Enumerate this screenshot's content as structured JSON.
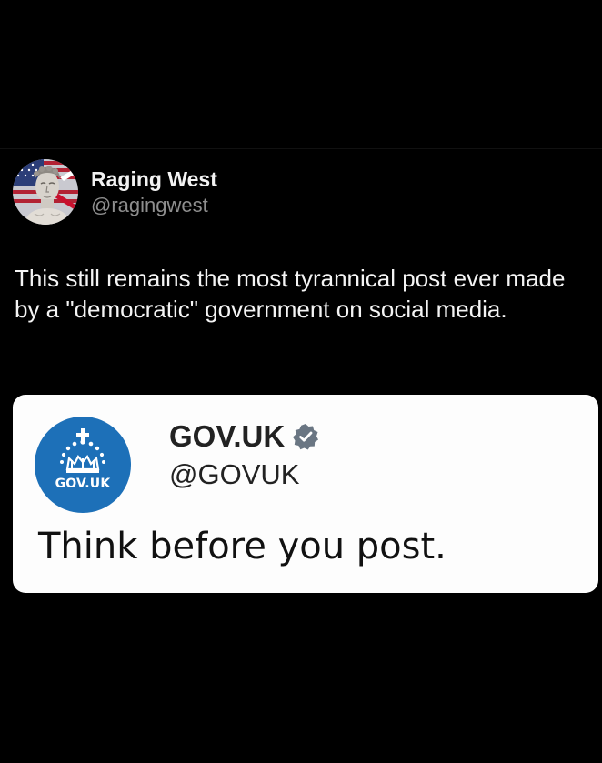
{
  "post": {
    "author": {
      "name": "Raging West",
      "handle": "@ragingwest",
      "avatar_icon": "statue-bust-with-union-flag-avatar"
    },
    "text": "This still remains the most tyrannical post ever made by a \"democratic\" government on social media."
  },
  "quoted_post": {
    "author": {
      "name": "GOV.UK",
      "handle": "@GOVUK",
      "verified": true,
      "logo_icon": "gov-uk-crown-logo",
      "logo_text": "GOV.UK"
    },
    "text": "Think before you post."
  },
  "colors": {
    "background": "#000000",
    "card_background": "#fdfdfd",
    "gov_blue": "#1d70b8",
    "verified_badge": "#6a7683",
    "handle_gray": "#8e8e8e"
  }
}
